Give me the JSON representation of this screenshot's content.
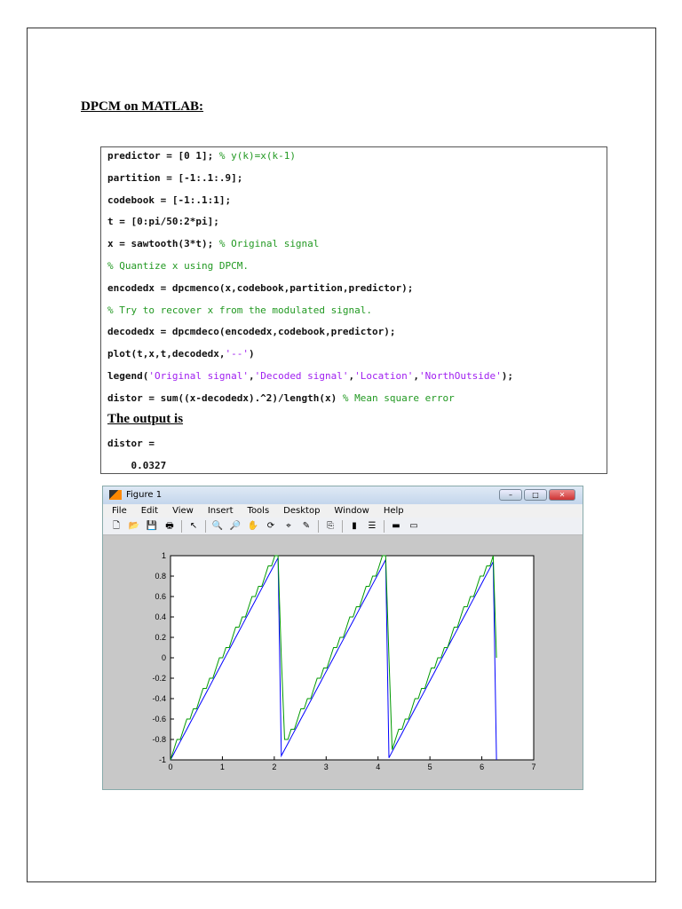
{
  "title": "DPCM on MATLAB:",
  "code_lines": [
    [
      {
        "t": "predictor = [0 1]; ",
        "k": "n"
      },
      {
        "t": "% y(k)=x(k-1)",
        "k": "c"
      }
    ],
    [
      {
        "t": "partition = [-1:.1:.9];",
        "k": "n"
      }
    ],
    [
      {
        "t": "codebook = [-1:.1:1];",
        "k": "n"
      }
    ],
    [
      {
        "t": "t = [0:pi/50:2*pi];",
        "k": "n"
      }
    ],
    [
      {
        "t": "x = sawtooth(3*t); ",
        "k": "n"
      },
      {
        "t": "% Original signal",
        "k": "c"
      }
    ],
    [
      {
        "t": "% Quantize x using DPCM.",
        "k": "c"
      }
    ],
    [
      {
        "t": "encodedx = dpcmenco(x,codebook,partition,predictor);",
        "k": "n"
      }
    ],
    [
      {
        "t": "% Try to recover x from the modulated signal.",
        "k": "c"
      }
    ],
    [
      {
        "t": "decodedx = dpcmdeco(encodedx,codebook,predictor);",
        "k": "n"
      }
    ],
    [
      {
        "t": "plot(t,x,t,decodedx,",
        "k": "n"
      },
      {
        "t": "'--'",
        "k": "s"
      },
      {
        "t": ")",
        "k": "n"
      }
    ],
    [
      {
        "t": "legend(",
        "k": "n"
      },
      {
        "t": "'Original signal'",
        "k": "s"
      },
      {
        "t": ",",
        "k": "n"
      },
      {
        "t": "'Decoded signal'",
        "k": "s"
      },
      {
        "t": ",",
        "k": "n"
      },
      {
        "t": "'Location'",
        "k": "s"
      },
      {
        "t": ",",
        "k": "n"
      },
      {
        "t": "'NorthOutside'",
        "k": "s"
      },
      {
        "t": ");",
        "k": "n"
      }
    ],
    [
      {
        "t": "distor = sum((x-decodedx).^2)/length(x) ",
        "k": "n"
      },
      {
        "t": "% Mean square error",
        "k": "c"
      }
    ]
  ],
  "output_heading": "The output is",
  "output_lines": [
    "distor =",
    "    0.0327"
  ],
  "figure": {
    "title": "Figure 1",
    "menu": [
      "File",
      "Edit",
      "View",
      "Insert",
      "Tools",
      "Desktop",
      "Window",
      "Help"
    ],
    "toolbar": [
      "new-icon",
      "open-icon",
      "save-icon",
      "print-icon",
      "pointer-icon",
      "zoom-in-icon",
      "zoom-out-icon",
      "pan-icon",
      "rotate-icon",
      "datacursor-icon",
      "brush-icon",
      "link-icon",
      "colorbar-icon",
      "legend-icon",
      "hide-tools-icon",
      "show-tools-icon"
    ]
  },
  "chart_data": {
    "type": "line",
    "title": "",
    "xlabel": "",
    "ylabel": "",
    "xlim": [
      0,
      7
    ],
    "ylim": [
      -1,
      1
    ],
    "xticks": [
      "0",
      "1",
      "2",
      "3",
      "4",
      "5",
      "6",
      "7"
    ],
    "yticks": [
      "-1",
      "-0.8",
      "-0.6",
      "-0.4",
      "-0.2",
      "0",
      "0.2",
      "0.4",
      "0.6",
      "0.8",
      "1"
    ],
    "t": {
      "start": 0,
      "step_over_pi": 0.02,
      "end_over_pi": 2
    },
    "codebook": {
      "start": -1,
      "step": 0.1,
      "end": 1
    },
    "partition": {
      "start": -1,
      "step": 0.1,
      "end": 0.9
    },
    "series": [
      {
        "name": "Original signal",
        "formula": "sawtooth(3*t)",
        "color": "#0000ff"
      },
      {
        "name": "Decoded signal",
        "formula": "dpcmdeco(dpcmenco(x))",
        "color": "#009900"
      }
    ]
  }
}
